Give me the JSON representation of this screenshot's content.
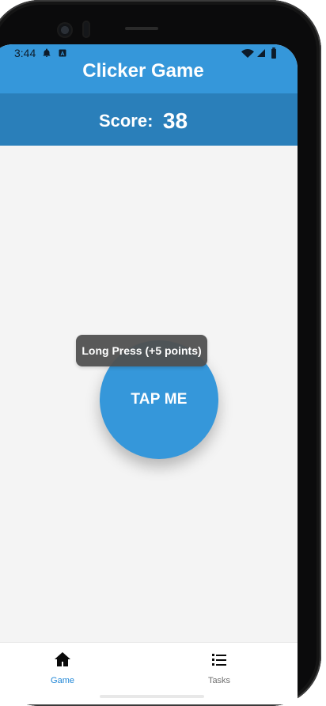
{
  "status": {
    "time": "3:44",
    "icons": [
      "bell-icon",
      "a-icon",
      "wifi-icon",
      "signal-icon",
      "battery-icon"
    ]
  },
  "app": {
    "title": "Clicker Game",
    "score_label": "Score:",
    "score_value": "38",
    "tap_label": "TAP ME",
    "tooltip": "Long Press (+5 points)"
  },
  "nav": {
    "items": [
      {
        "label": "Game",
        "icon": "home-icon",
        "selected": true
      },
      {
        "label": "Tasks",
        "icon": "list-icon",
        "selected": false
      }
    ]
  },
  "colors": {
    "primary": "#3597da",
    "score_bg": "#2a7fba",
    "background": "#f4f4f4",
    "nav_selected": "#1f86d6",
    "nav_unselected": "#6f6f6f",
    "tooltip_bg": "#505050"
  }
}
